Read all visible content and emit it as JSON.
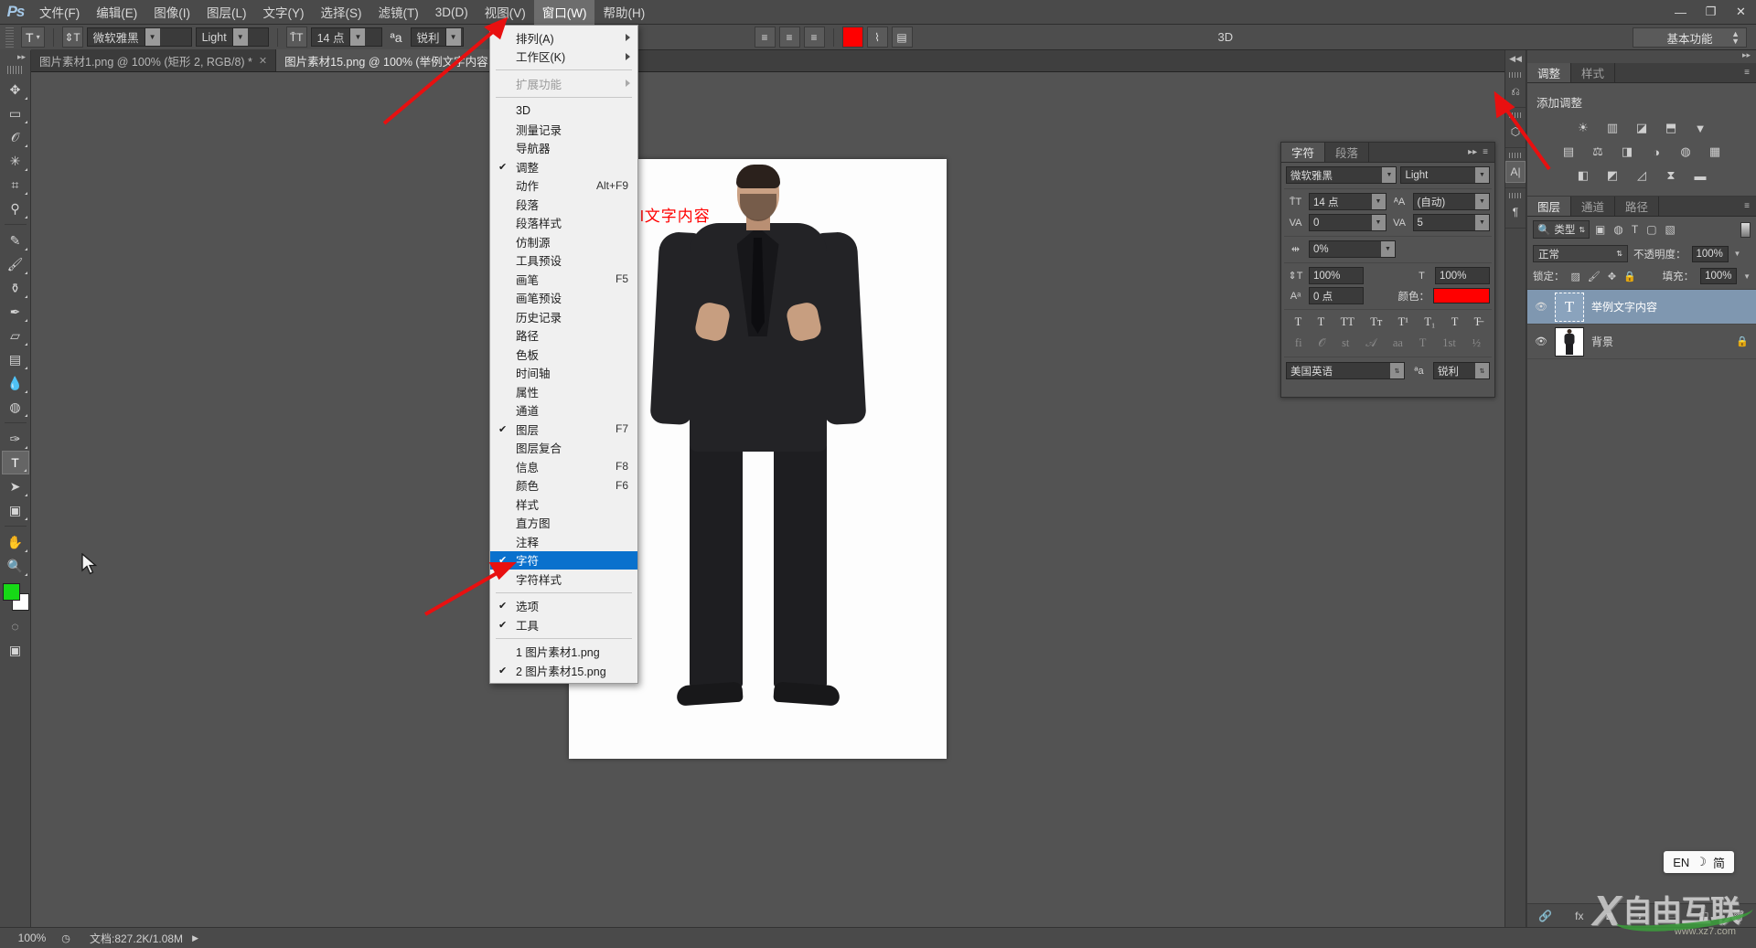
{
  "app": {
    "logo": "Ps"
  },
  "menubar": {
    "items": [
      {
        "label": "文件(F)",
        "active": false
      },
      {
        "label": "编辑(E)",
        "active": false
      },
      {
        "label": "图像(I)",
        "active": false
      },
      {
        "label": "图层(L)",
        "active": false
      },
      {
        "label": "文字(Y)",
        "active": false
      },
      {
        "label": "选择(S)",
        "active": false
      },
      {
        "label": "滤镜(T)",
        "active": false
      },
      {
        "label": "3D(D)",
        "active": false
      },
      {
        "label": "视图(V)",
        "active": false
      },
      {
        "label": "窗口(W)",
        "active": true
      },
      {
        "label": "帮助(H)",
        "active": false
      }
    ],
    "window_controls": {
      "minimize": "—",
      "maximize": "❐",
      "close": "✕"
    }
  },
  "options_bar": {
    "tool_glyph": "T",
    "orientation_glyph": "⇕T",
    "font_family": "微软雅黑",
    "font_style": "Light",
    "font_size": "14 点",
    "aa_label": "ªa",
    "anti_alias": "锐利",
    "label_3d": "3D",
    "workspace": "基本功能"
  },
  "document_tabs": [
    {
      "label": "图片素材1.png @ 100% (矩形 2, RGB/8) *",
      "active": false,
      "close": "✕"
    },
    {
      "label": "图片素材15.png @ 100% (举例文字内容",
      "active": true,
      "close": ""
    }
  ],
  "toolbar": {
    "tools": [
      {
        "name": "move-tool",
        "glyph": "✥",
        "selected": false
      },
      {
        "name": "marquee-tool",
        "glyph": "▭",
        "selected": false
      },
      {
        "name": "lasso-tool",
        "glyph": "𝒪",
        "selected": false
      },
      {
        "name": "magic-wand-tool",
        "glyph": "✳",
        "selected": false
      },
      {
        "name": "crop-tool",
        "glyph": "⌗",
        "selected": false
      },
      {
        "name": "eyedropper-tool",
        "glyph": "⚲",
        "selected": false
      },
      {
        "name": "healing-brush-tool",
        "glyph": "✎",
        "selected": false
      },
      {
        "name": "brush-tool",
        "glyph": "🖌",
        "selected": false
      },
      {
        "name": "clone-stamp-tool",
        "glyph": "⚱",
        "selected": false
      },
      {
        "name": "history-brush-tool",
        "glyph": "✒",
        "selected": false
      },
      {
        "name": "eraser-tool",
        "glyph": "▱",
        "selected": false
      },
      {
        "name": "gradient-tool",
        "glyph": "▤",
        "selected": false
      },
      {
        "name": "blur-tool",
        "glyph": "💧",
        "selected": false
      },
      {
        "name": "dodge-tool",
        "glyph": "◍",
        "selected": false
      },
      {
        "name": "pen-tool",
        "glyph": "✑",
        "selected": false
      },
      {
        "name": "type-tool",
        "glyph": "T",
        "selected": true
      },
      {
        "name": "path-selection-tool",
        "glyph": "➤",
        "selected": false
      },
      {
        "name": "rectangle-tool",
        "glyph": "▣",
        "selected": false
      },
      {
        "name": "hand-tool",
        "glyph": "✋",
        "selected": false
      },
      {
        "name": "zoom-tool",
        "glyph": "🔍",
        "selected": false
      }
    ],
    "foreground_color": "#16d916",
    "background_color": "#ffffff",
    "quickmask_glyph": "◌"
  },
  "window_menu": {
    "items": [
      {
        "label": "排列(A)",
        "shortcut": "",
        "checked": false,
        "submenu": true,
        "disabled": false,
        "selected": false
      },
      {
        "label": "工作区(K)",
        "shortcut": "",
        "checked": false,
        "submenu": true,
        "disabled": false,
        "selected": false
      },
      {
        "separator": true
      },
      {
        "label": "扩展功能",
        "shortcut": "",
        "checked": false,
        "submenu": true,
        "disabled": true,
        "selected": false
      },
      {
        "separator": true
      },
      {
        "label": "3D",
        "shortcut": "",
        "checked": false,
        "submenu": false,
        "disabled": false,
        "selected": false
      },
      {
        "label": "测量记录",
        "shortcut": "",
        "checked": false,
        "submenu": false,
        "disabled": false,
        "selected": false
      },
      {
        "label": "导航器",
        "shortcut": "",
        "checked": false,
        "submenu": false,
        "disabled": false,
        "selected": false
      },
      {
        "label": "调整",
        "shortcut": "",
        "checked": true,
        "submenu": false,
        "disabled": false,
        "selected": false
      },
      {
        "label": "动作",
        "shortcut": "Alt+F9",
        "checked": false,
        "submenu": false,
        "disabled": false,
        "selected": false
      },
      {
        "label": "段落",
        "shortcut": "",
        "checked": false,
        "submenu": false,
        "disabled": false,
        "selected": false
      },
      {
        "label": "段落样式",
        "shortcut": "",
        "checked": false,
        "submenu": false,
        "disabled": false,
        "selected": false
      },
      {
        "label": "仿制源",
        "shortcut": "",
        "checked": false,
        "submenu": false,
        "disabled": false,
        "selected": false
      },
      {
        "label": "工具预设",
        "shortcut": "",
        "checked": false,
        "submenu": false,
        "disabled": false,
        "selected": false
      },
      {
        "label": "画笔",
        "shortcut": "F5",
        "checked": false,
        "submenu": false,
        "disabled": false,
        "selected": false
      },
      {
        "label": "画笔预设",
        "shortcut": "",
        "checked": false,
        "submenu": false,
        "disabled": false,
        "selected": false
      },
      {
        "label": "历史记录",
        "shortcut": "",
        "checked": false,
        "submenu": false,
        "disabled": false,
        "selected": false
      },
      {
        "label": "路径",
        "shortcut": "",
        "checked": false,
        "submenu": false,
        "disabled": false,
        "selected": false
      },
      {
        "label": "色板",
        "shortcut": "",
        "checked": false,
        "submenu": false,
        "disabled": false,
        "selected": false
      },
      {
        "label": "时间轴",
        "shortcut": "",
        "checked": false,
        "submenu": false,
        "disabled": false,
        "selected": false
      },
      {
        "label": "属性",
        "shortcut": "",
        "checked": false,
        "submenu": false,
        "disabled": false,
        "selected": false
      },
      {
        "label": "通道",
        "shortcut": "",
        "checked": false,
        "submenu": false,
        "disabled": false,
        "selected": false
      },
      {
        "label": "图层",
        "shortcut": "F7",
        "checked": true,
        "submenu": false,
        "disabled": false,
        "selected": false
      },
      {
        "label": "图层复合",
        "shortcut": "",
        "checked": false,
        "submenu": false,
        "disabled": false,
        "selected": false
      },
      {
        "label": "信息",
        "shortcut": "F8",
        "checked": false,
        "submenu": false,
        "disabled": false,
        "selected": false
      },
      {
        "label": "颜色",
        "shortcut": "F6",
        "checked": false,
        "submenu": false,
        "disabled": false,
        "selected": false
      },
      {
        "label": "样式",
        "shortcut": "",
        "checked": false,
        "submenu": false,
        "disabled": false,
        "selected": false
      },
      {
        "label": "直方图",
        "shortcut": "",
        "checked": false,
        "submenu": false,
        "disabled": false,
        "selected": false
      },
      {
        "label": "注释",
        "shortcut": "",
        "checked": false,
        "submenu": false,
        "disabled": false,
        "selected": false
      },
      {
        "label": "字符",
        "shortcut": "",
        "checked": true,
        "submenu": false,
        "disabled": false,
        "selected": true
      },
      {
        "label": "字符样式",
        "shortcut": "",
        "checked": false,
        "submenu": false,
        "disabled": false,
        "selected": false
      },
      {
        "separator": true
      },
      {
        "label": "选项",
        "shortcut": "",
        "checked": true,
        "submenu": false,
        "disabled": false,
        "selected": false
      },
      {
        "label": "工具",
        "shortcut": "",
        "checked": true,
        "submenu": false,
        "disabled": false,
        "selected": false
      },
      {
        "separator": true
      },
      {
        "label": "1 图片素材1.png",
        "shortcut": "",
        "checked": false,
        "submenu": false,
        "disabled": false,
        "selected": false
      },
      {
        "label": "2 图片素材15.png",
        "shortcut": "",
        "checked": true,
        "submenu": false,
        "disabled": false,
        "selected": false
      }
    ]
  },
  "canvas": {
    "overlay_text": "l文字内容",
    "overlay_text_color": "#ff0000"
  },
  "character_panel": {
    "tabs": [
      {
        "label": "字符",
        "active": true
      },
      {
        "label": "段落",
        "active": false
      }
    ],
    "font_family": "微软雅黑",
    "font_style": "Light",
    "font_size_icon": "T̄T",
    "font_size": "14 点",
    "leading_icon": "ᴬA",
    "leading": "(自动)",
    "kerning_icon": "VA",
    "kerning": "0",
    "tracking_icon": "VA",
    "tracking": "5",
    "vscale_icon": "⇕T",
    "vscale": "100%",
    "hscale_icon": "T",
    "hscale": "100%",
    "baseline_icon": "Aᵃ",
    "baseline": "0 点",
    "tsume_icon": "⇹",
    "tsume": "0%",
    "color_label": "颜色：",
    "color_value": "#ff0000",
    "style_buttons": [
      "T",
      "T",
      "TT",
      "Tт",
      "T¹",
      "T₁",
      "T",
      "T̶"
    ],
    "ot_buttons": [
      "fi",
      "𝒪",
      "st",
      "𝒜",
      "aa",
      "T",
      "1st",
      "½"
    ],
    "language": "美国英语",
    "aa_icon": "ªa",
    "anti_alias": "锐利"
  },
  "icon_dock": {
    "collapse_glyph": "◀◀",
    "buttons": [
      {
        "name": "history-dock-icon",
        "glyph": "⎌",
        "active": false
      },
      {
        "name": "3d-dock-icon",
        "glyph": "⬡",
        "active": false
      },
      {
        "name": "character-dock-icon",
        "glyph": "A|",
        "active": true
      },
      {
        "name": "paragraph-dock-icon",
        "glyph": "¶",
        "active": false
      }
    ]
  },
  "adjustments_panel": {
    "tabs": [
      {
        "label": "调整",
        "active": true
      },
      {
        "label": "样式",
        "active": false
      }
    ],
    "title": "添加调整",
    "icons_row1": [
      "☀",
      "▥",
      "◪",
      "⬒",
      "▼"
    ],
    "icons_row2": [
      "▤",
      "⚖",
      "◨",
      "◑",
      "◍",
      "▦"
    ],
    "icons_row3": [
      "◧",
      "◩",
      "◿",
      "⧗",
      "▬"
    ]
  },
  "layers_panel": {
    "tabs": [
      {
        "label": "图层",
        "active": true
      },
      {
        "label": "通道",
        "active": false
      },
      {
        "label": "路径",
        "active": false
      }
    ],
    "filter_label": "类型",
    "filter_icon": "🔍",
    "filter_type_icons": [
      "▣",
      "◍",
      "T",
      "▢",
      "▧"
    ],
    "blend_mode": "正常",
    "opacity_label": "不透明度：",
    "opacity_value": "100%",
    "lock_label": "锁定：",
    "lock_icons": [
      "▨",
      "🖌",
      "✥",
      "🔒"
    ],
    "fill_label": "填充：",
    "fill_value": "100%",
    "layers": [
      {
        "name": "举例文字内容",
        "type": "text",
        "visible": true,
        "selected": true,
        "locked": false,
        "thumb_glyph": "T"
      },
      {
        "name": "背景",
        "type": "image",
        "visible": true,
        "selected": false,
        "locked": true,
        "thumb_glyph": ""
      }
    ],
    "bottom_icons": [
      "🔗",
      "fx",
      "◙",
      "◑",
      "🗀",
      "⬓",
      "🗑"
    ]
  },
  "status_bar": {
    "zoom": "100%",
    "clock_glyph": "◷",
    "doc_info": "文档:827.2K/1.08M",
    "expand_glyph": "▶"
  },
  "ime": {
    "lang": "EN",
    "moon": "☽",
    "mode": "简"
  },
  "watermark": {
    "x": "X",
    "text": "自由互联",
    "url": "www.xz7.com"
  }
}
